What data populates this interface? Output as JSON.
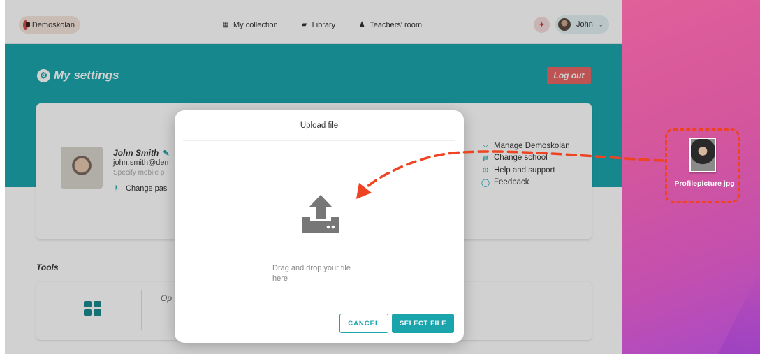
{
  "colors": {
    "accent": "#1aa5ad",
    "logout": "#e86666",
    "annotation": "#ee4422"
  },
  "topnav": {
    "school_pill": "Demoskolan",
    "links": [
      {
        "icon": "grid-icon",
        "label": "My collection"
      },
      {
        "icon": "book-icon",
        "label": "Library"
      },
      {
        "icon": "people-icon",
        "label": "Teachers' room"
      }
    ],
    "user_name": "John"
  },
  "settings": {
    "title": "My settings",
    "logout_label": "Log out",
    "profile": {
      "name": "John Smith",
      "email": "john.smith@dem",
      "mobile_placeholder": "Specify mobile p",
      "change_password": "Change pas"
    },
    "links": [
      {
        "icon": "shield-icon",
        "label": "Manage Demoskolan"
      },
      {
        "icon": "swap-icon",
        "label": "Change school"
      },
      {
        "icon": "lifebuoy-icon",
        "label": "Help and support"
      },
      {
        "icon": "chat-icon",
        "label": "Feedback"
      }
    ],
    "tools_title": "Tools",
    "tools_item_partial": "Op"
  },
  "modal": {
    "title": "Upload file",
    "drop_text": "Drag and drop your file here",
    "cancel_label": "CANCEL",
    "select_label": "SELECT FILE"
  },
  "desktop": {
    "file_name": "Profilepicture jpg"
  }
}
